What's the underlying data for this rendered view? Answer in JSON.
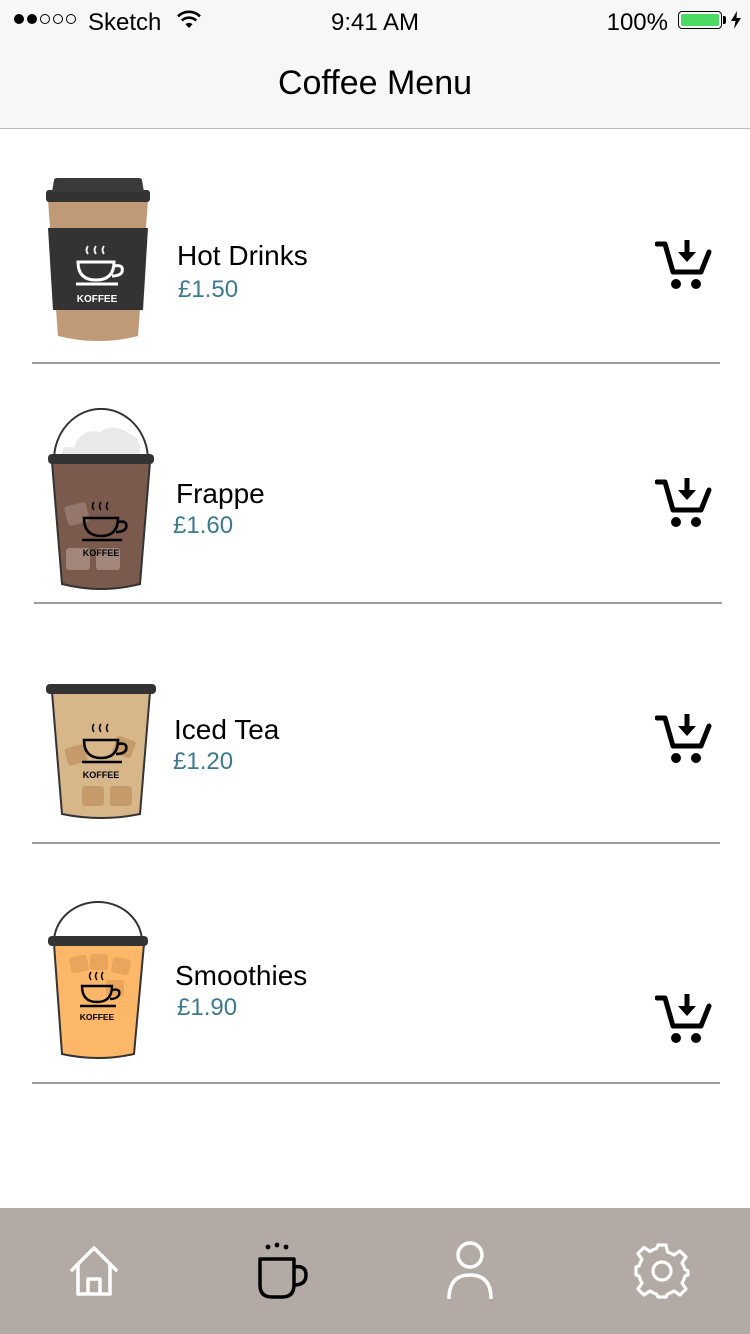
{
  "status_bar": {
    "carrier": "Sketch",
    "time": "9:41 AM",
    "battery": "100%"
  },
  "nav": {
    "title": "Coffee Menu"
  },
  "menu": {
    "items": [
      {
        "name": "Hot Drinks",
        "price": "£1.50",
        "cup_icon": "hot-cup-icon",
        "cup_label": "KOFFEE"
      },
      {
        "name": "Frappe",
        "price": "£1.60",
        "cup_icon": "frappe-cup-icon",
        "cup_label": "KOFFEE"
      },
      {
        "name": "Iced Tea",
        "price": "£1.20",
        "cup_icon": "iced-tea-cup-icon",
        "cup_label": "KOFFEE"
      },
      {
        "name": "Smoothies",
        "price": "£1.90",
        "cup_icon": "smoothie-cup-icon",
        "cup_label": "KOFFEE"
      }
    ],
    "cart_icon": "add-to-cart-icon"
  },
  "tab_bar": {
    "tabs": [
      {
        "icon": "home-icon",
        "active": false
      },
      {
        "icon": "coffee-cup-icon",
        "active": true
      },
      {
        "icon": "profile-icon",
        "active": false
      },
      {
        "icon": "settings-icon",
        "active": false
      }
    ]
  },
  "colors": {
    "price": "#3d7a8c",
    "tab_bar_bg": "#b4aaa5",
    "battery_fill": "#4cd964",
    "nav_bg": "#f7f7f7"
  }
}
